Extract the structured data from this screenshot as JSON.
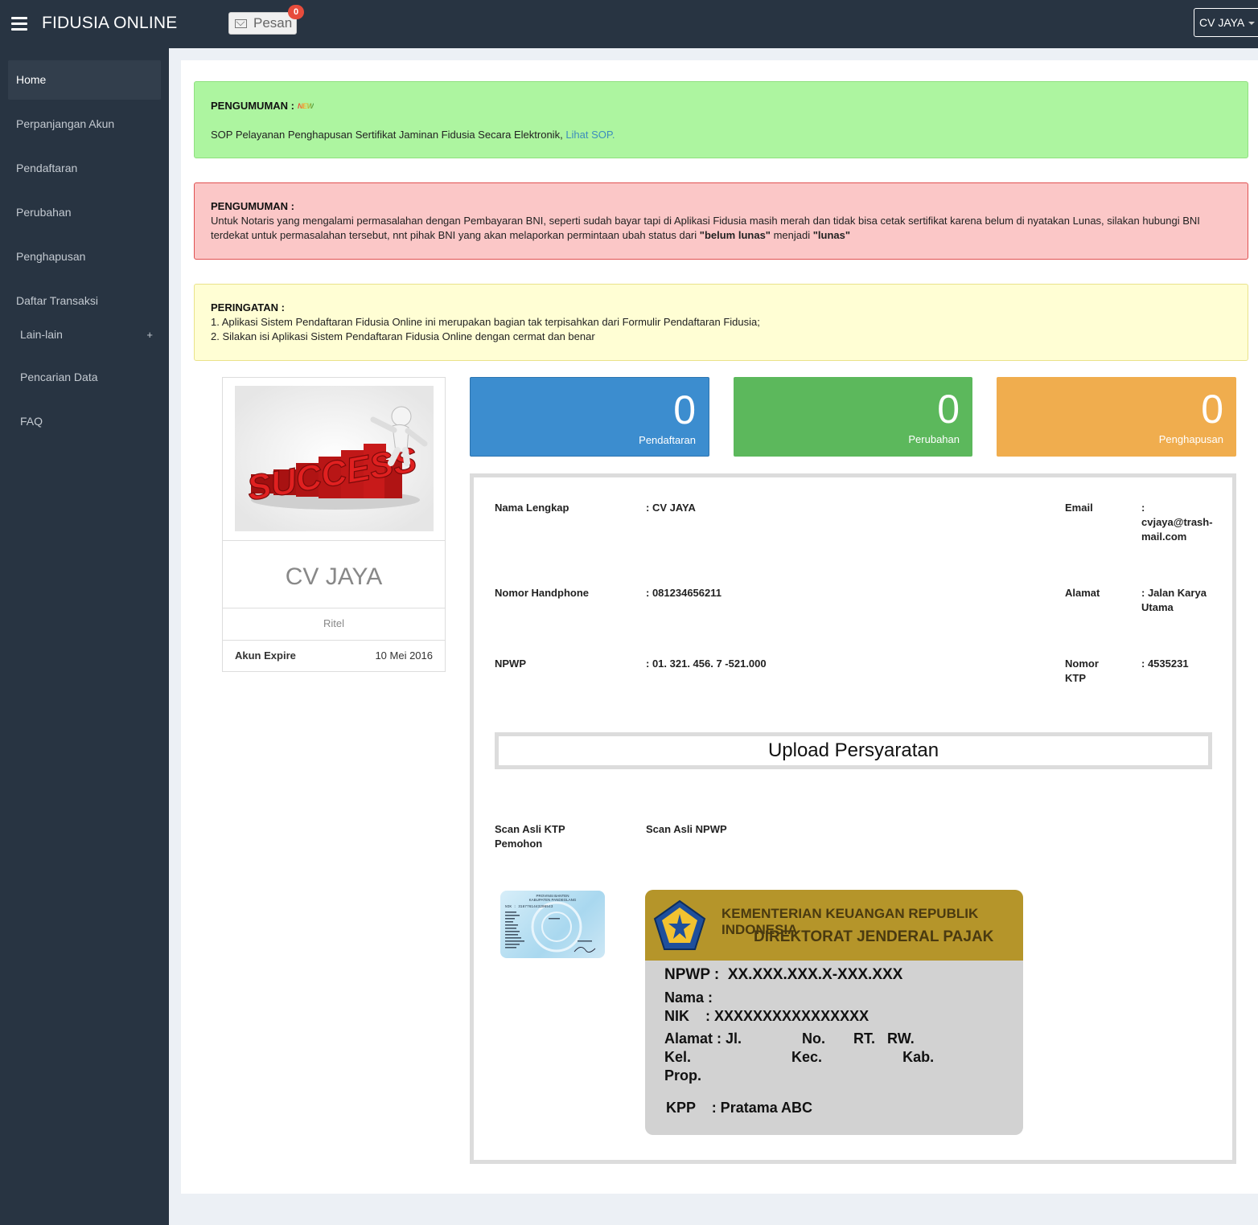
{
  "header": {
    "brand": "FIDUSIA ONLINE",
    "messages_label": "Pesan",
    "messages_count": "0",
    "user_menu": "CV JAYA"
  },
  "sidebar": {
    "items": [
      {
        "label": "Home"
      },
      {
        "label": "Perpanjangan Akun"
      },
      {
        "label": "Pendaftaran"
      },
      {
        "label": "Perubahan"
      },
      {
        "label": "Penghapusan"
      },
      {
        "label": "Daftar Transaksi"
      },
      {
        "label": "Lain-lain",
        "expand_symbol": "+"
      },
      {
        "label": "Pencarian Data"
      },
      {
        "label": "FAQ"
      }
    ]
  },
  "announcements": {
    "green": {
      "title": "PENGUMUMAN :",
      "badge": "NEW",
      "text": "SOP Pelayanan Penghapusan Sertifikat Jaminan Fidusia Secara Elektronik,",
      "link": "Lihat SOP."
    },
    "red": {
      "title": "PENGUMUMAN :",
      "text": "Untuk Notaris yang mengalami permasalahan dengan Pembayaran BNI, seperti sudah bayar tapi di Aplikasi Fidusia masih merah dan tidak bisa cetak sertifikat karena belum di nyatakan Lunas, silakan hubungi BNI terdekat untuk permasalahan tersebut, nnt pihak BNI yang akan melaporkan permintaan ubah status dari",
      "bold1": "\"belum lunas\"",
      "mid": "menjadi",
      "bold2": "\"lunas\""
    },
    "yellow": {
      "title": "PERINGATAN :",
      "line1": "1. Aplikasi Sistem Pendaftaran Fidusia Online ini merupakan bagian tak terpisahkan dari Formulir Pendaftaran Fidusia;",
      "line2": "2. Silakan isi Aplikasi Sistem Pendaftaran Fidusia Online dengan cermat dan benar"
    }
  },
  "profile": {
    "image_text": "SUCCESS",
    "name": "CV JAYA",
    "type": "Ritel",
    "expire_label": "Akun Expire",
    "expire_value": "10 Mei 2016"
  },
  "stats": [
    {
      "value": "0",
      "label": "Pendaftaran",
      "color": "#3c8dcf"
    },
    {
      "value": "0",
      "label": "Perubahan",
      "color": "#5cb85c"
    },
    {
      "value": "0",
      "label": "Penghapusan",
      "color": "#f0ad4e"
    }
  ],
  "details": {
    "nama_label": "Nama Lengkap",
    "nama_value": ": CV JAYA",
    "email_label": "Email",
    "email_colon": ":",
    "email_value": "cvjaya@trash-mail.com",
    "hp_label": "Nomor Handphone",
    "hp_value": ": 081234656211",
    "alamat_label": "Alamat",
    "alamat_value": ": Jalan Karya Utama",
    "npwp_label": "NPWP",
    "npwp_value": ": 01. 321. 456. 7 -521.000",
    "ktp_label": "Nomor KTP",
    "ktp_value": ": 4535231"
  },
  "upload": {
    "title": "Upload Persyaratan",
    "ktp_label": "Scan Asli KTP Pemohon",
    "npwp_label": "Scan Asli NPWP"
  },
  "ktp_card": {
    "province": "PROVINSI BANTEN",
    "regency": "KABUPATEN PANDEGLANG",
    "nik": "NIK : 3167761443206543"
  },
  "npwp_card": {
    "line1": "KEMENTERIAN KEUANGAN REPUBLIK INDONESIA",
    "line2": "DIREKTORAT JENDERAL PAJAK",
    "npwp": "NPWP :  XX.XXX.XXX.X-XXX.XXX",
    "nama": "Nama :",
    "nik": "NIK    : XXXXXXXXXXXXXXXX",
    "alamat": "Alamat : Jl.               No.       RT.   RW.",
    "kel": "Kel.                         Kec.                    Kab.",
    "prop": "Prop.",
    "kpp": "KPP    : Pratama ABC"
  }
}
